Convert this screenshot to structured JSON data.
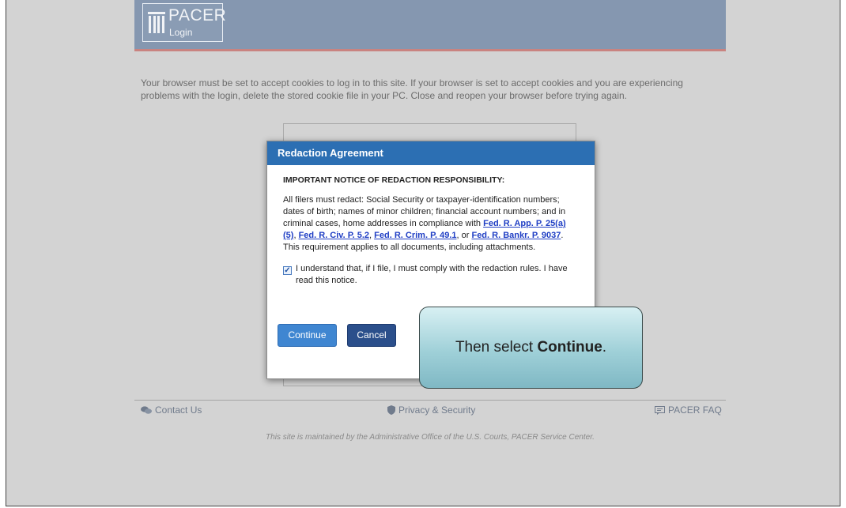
{
  "header": {
    "logo_title": "PACER",
    "logo_subtitle": "Login"
  },
  "notice_text": "Your browser must be set to accept cookies to log in to this site. If your browser is set to accept cookies and you are experiencing problems with the login, delete the stored cookie file in your PC. Close and reopen your browser before trying again.",
  "modal": {
    "title": "Redaction Agreement",
    "heading": "IMPORTANT NOTICE OF REDACTION RESPONSIBILITY:",
    "body_part1": "All filers must redact: Social Security or taxpayer-identification numbers; dates of birth; names of minor children; financial account numbers; and in criminal cases, home addresses in compliance with ",
    "links": [
      "Fed. R. App. P. 25(a)(5)",
      "Fed. R. Civ. P. 5.2",
      "Fed. R. Crim. P. 49.1",
      "Fed. R. Bankr. P. 9037"
    ],
    "sep1": ", ",
    "sep2": ", ",
    "sep3": ", or ",
    "body_end": ". This requirement applies to all documents, including attachments.",
    "checkbox_label": "I understand that, if I file, I must comply with the redaction rules. I have read this notice.",
    "checkbox_checked": true,
    "continue_label": "Continue",
    "cancel_label": "Cancel"
  },
  "callout": {
    "prefix": "Then select ",
    "emphasis": "Continue",
    "suffix": "."
  },
  "footer": {
    "contact": "Contact Us",
    "privacy": "Privacy & Security",
    "faq": "PACER FAQ",
    "maintained_by": "This site is maintained by the Administrative Office of the U.S. Courts, PACER Service Center."
  },
  "colors": {
    "banner": "#8597b0",
    "modal_header": "#2c6fb3",
    "continue_button": "#3f86d1",
    "cancel_button": "#2b4f8b",
    "link": "#1f3ec4"
  },
  "icons": [
    "pillars-icon",
    "chat-icon",
    "shield-icon",
    "faq-icon",
    "check-icon"
  ]
}
